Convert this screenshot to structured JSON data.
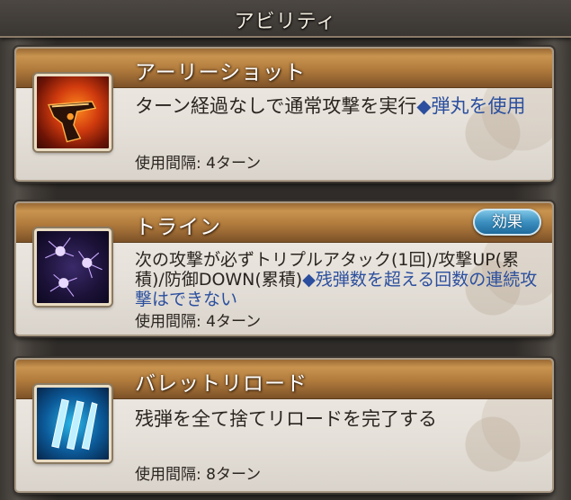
{
  "panel": {
    "title": "アビリティ"
  },
  "abilities": [
    {
      "name": "アーリーショット",
      "icon": "pistol-icon",
      "desc_plain": "ターン経過なしで通常攻撃を実行",
      "desc_blue": "◆弾丸を使用",
      "interval": "使用間隔: 4ターン"
    },
    {
      "name": "トライン",
      "icon": "bullet-holes-icon",
      "desc_plain": "次の攻撃が必ずトリプルアタック(1回)/攻撃UP(累積)/防御DOWN(累積)",
      "desc_blue": "◆残弾数を超える回数の連続攻撃はできない",
      "interval": "使用間隔: 4ターン",
      "effect_label": "効果"
    },
    {
      "name": "バレットリロード",
      "icon": "reload-icon",
      "desc_plain": "残弾を全て捨てリロードを完了する",
      "interval": "使用間隔: 8ターン"
    }
  ],
  "colors": {
    "header_gold": "#b07a3c",
    "blue_text": "#2b4f9e",
    "effect_button": "#3b8fbf"
  }
}
